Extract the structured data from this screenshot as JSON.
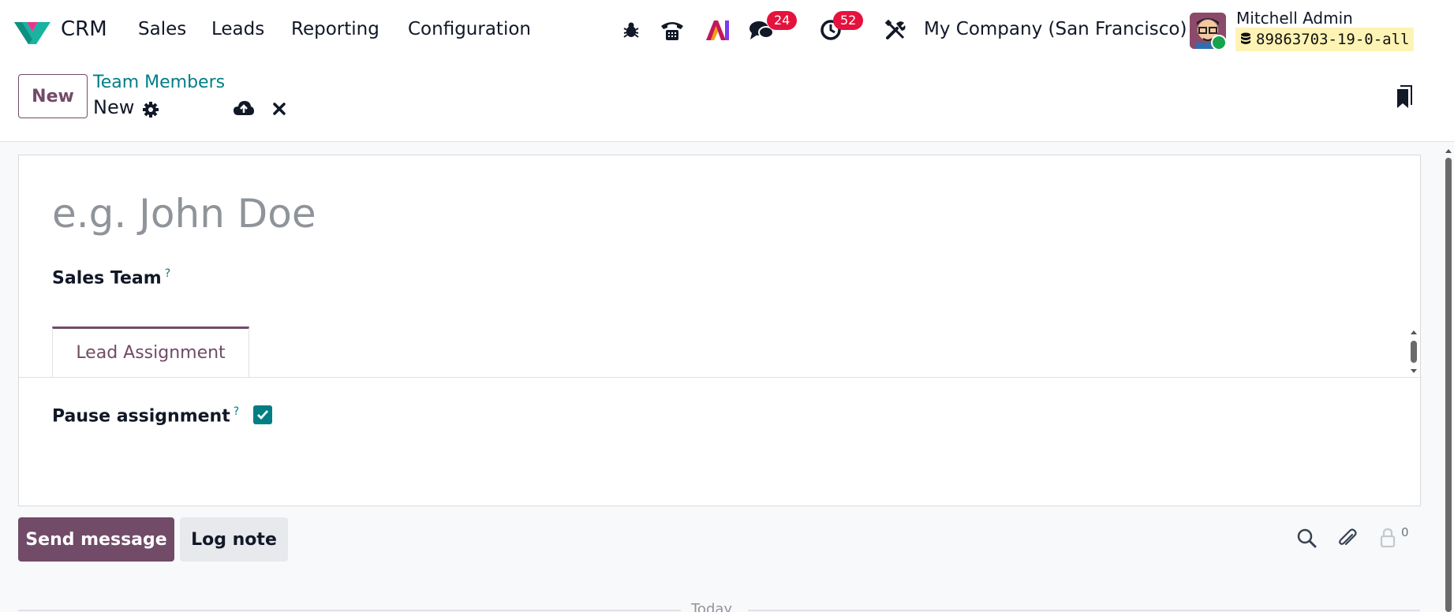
{
  "app": {
    "name": "CRM"
  },
  "menu": {
    "items": [
      "Sales",
      "Leads",
      "Reporting",
      "Configuration"
    ]
  },
  "systray": {
    "messages_count": "24",
    "activities_count": "52",
    "company": "My Company (San Francisco)",
    "user_name": "Mitchell Admin",
    "database": "89863703-19-0-all"
  },
  "control_panel": {
    "new_button": "New",
    "breadcrumb": "Team Members",
    "record_name": "New"
  },
  "form": {
    "name_placeholder": "e.g. John Doe",
    "sales_team_label": "Sales Team",
    "help_mark": "?",
    "tabs": [
      {
        "label": "Lead Assignment",
        "active": true
      }
    ],
    "pause_assignment_label": "Pause assignment",
    "pause_assignment_checked": true
  },
  "chatter": {
    "send_message": "Send message",
    "log_note": "Log note",
    "followers_count": "0",
    "date_separator": "Today"
  },
  "colors": {
    "brand": "#714b67",
    "accent": "#017e84",
    "badge": "#e5123d",
    "online": "#14a44d"
  },
  "icons": {
    "systray": [
      "bug-icon",
      "phone-icon",
      "ai-icon",
      "messages-icon",
      "activities-icon",
      "settings-tools-icon"
    ],
    "control_panel": [
      "gear-icon",
      "cloud-upload-icon",
      "close-icon",
      "bookmark-icon"
    ],
    "chatter": [
      "search-icon",
      "paperclip-icon",
      "followers-icon"
    ]
  }
}
